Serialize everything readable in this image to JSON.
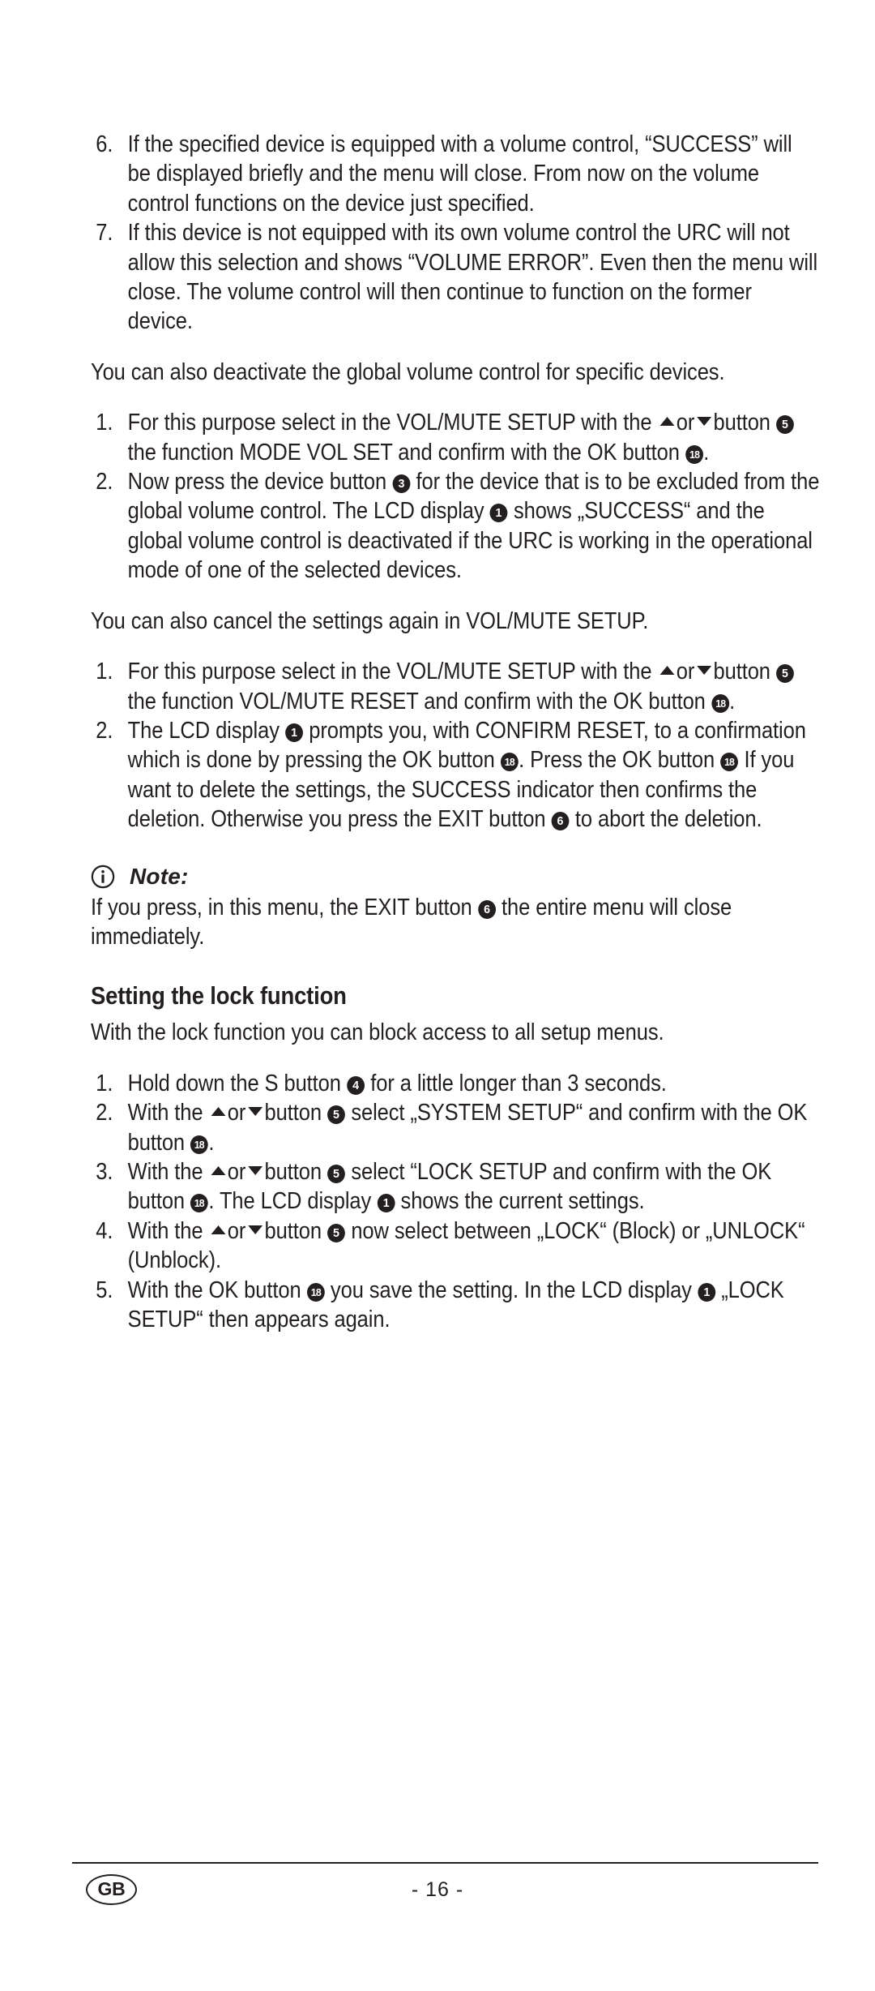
{
  "document": {
    "language_badge": "GB",
    "page_number": "- 16 -",
    "text_color": "#231f20",
    "background_color": "#ffffff"
  },
  "content": {
    "list_a": {
      "items": [
        {
          "num": "6.",
          "text": "If the specified device is equipped with a volume control, “SUCCESS” will be displayed briefly and the menu will close. From now on the volume control functions on the device just specified."
        },
        {
          "num": "7.",
          "text": "If this device is not equipped with its own volume control the URC will not allow this selection and shows “VOLUME ERROR”. Even then the menu will close. The volume control will then continue to function on the former device."
        }
      ]
    },
    "para_1": "You can also deactivate the global volume control for specific devices.",
    "list_b": {
      "item1": {
        "num": "1.",
        "part1": "For this purpose select in the VOL/MUTE SETUP with the",
        "part2": "or",
        "part3": "button",
        "badge1": "5",
        "part4": "the function MODE VOL SET and confirm with the OK button",
        "badge2": "18",
        "part5": "."
      },
      "item2": {
        "num": "2.",
        "part1": "Now press the device button",
        "badge1": "3",
        "part2": "for the device that is to be excluded from the global volume control. The LCD display",
        "badge2": "1",
        "part3": "shows „SUCCESS“ and the global volume control is deactivated if the URC is working in the operational mode of one of the selected devices."
      }
    },
    "para_2": "You can also cancel the settings again in VOL/MUTE SETUP.",
    "list_c": {
      "item1": {
        "num": "1.",
        "part1": "For this purpose select in the VOL/MUTE SETUP with the",
        "part2": "or",
        "part3": "button",
        "badge1": "5",
        "part4": "the function VOL/MUTE RESET and confirm with the OK button",
        "badge2": "18",
        "part5": "."
      },
      "item2": {
        "num": "2.",
        "part1": "The LCD display",
        "badge1": "1",
        "part2": "prompts you, with CONFIRM RESET, to a confirmation which is done by pressing the OK button",
        "badge2": "18",
        "part3": ". Press the OK button",
        "badge3": "18",
        "part4": "If you want to delete the settings, the SUCCESS indicator then confirms the deletion. Otherwise you press the EXIT button",
        "badge4": "6",
        "part5": "to abort the deletion."
      }
    },
    "note": {
      "icon": "info-circle-icon",
      "label": "Note:",
      "part1": "If you press, in this menu, the EXIT button",
      "badge1": "6",
      "part2": "the entire menu will close immediately."
    },
    "section": {
      "title": "Setting the lock function",
      "intro": "With the lock function you can block access to all setup menus."
    },
    "list_d": {
      "item1": {
        "num": "1.",
        "part1": "Hold down the S button",
        "badge1": "4",
        "part2": "for a little longer than 3 seconds."
      },
      "item2": {
        "num": "2.",
        "part1": "With the",
        "part2": "or",
        "part3": "button",
        "badge1": "5",
        "part4": "select „SYSTEM SETUP“ and confirm with the OK button",
        "badge2": "18",
        "part5": "."
      },
      "item3": {
        "num": "3.",
        "part1": "With the",
        "part2": "or",
        "part3": "button",
        "badge1": "5",
        "part4": "select “LOCK SETUP and confirm with the OK button",
        "badge2": "18",
        "part5": ". The LCD display",
        "badge3": "1",
        "part6": "shows the current settings."
      },
      "item4": {
        "num": "4.",
        "part1": "With the",
        "part2": "or",
        "part3": "button",
        "badge1": "5",
        "part4": "now select between „LOCK“ (Block) or „UNLOCK“ (Unblock)."
      },
      "item5": {
        "num": "5.",
        "part1": "With the OK button",
        "badge1": "18",
        "part2": "you save the setting. In the LCD display",
        "badge2": "1",
        "part3": "„LOCK SETUP“ then appears again."
      }
    }
  }
}
